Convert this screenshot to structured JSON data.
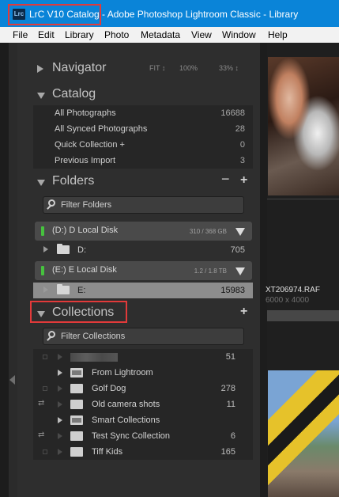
{
  "window": {
    "title": "Adobe Photoshop Lightroom Classic - Library",
    "catalog_label": "LrC V10 Catalog",
    "app_icon": "Lrc"
  },
  "menu": [
    "File",
    "Edit",
    "Library",
    "Photo",
    "Metadata",
    "View",
    "Window",
    "Help"
  ],
  "navigator": {
    "title": "Navigator",
    "options": [
      "FIT ↕",
      "100%",
      "33% ↕"
    ]
  },
  "catalog": {
    "title": "Catalog",
    "items": [
      {
        "label": "All Photographs",
        "count": "16688"
      },
      {
        "label": "All Synced Photographs",
        "count": "28"
      },
      {
        "label": "Quick Collection +",
        "count": "0"
      },
      {
        "label": "Previous Import",
        "count": "3"
      }
    ]
  },
  "folders": {
    "title": "Folders",
    "minus": "−",
    "plus": "+",
    "filter_placeholder": "Filter Folders",
    "volumes": [
      {
        "name": "(D:) D Local Disk",
        "size": "310 / 368 GB",
        "folder": "D:",
        "count": "705"
      },
      {
        "name": "(E:) E Local Disk",
        "size": "1.2 / 1.8 TB",
        "folder": "E:",
        "count": "15983"
      }
    ]
  },
  "collections": {
    "title": "Collections",
    "plus": "+",
    "filter_placeholder": "Filter Collections",
    "items": [
      {
        "label": "",
        "count": "51"
      },
      {
        "label": "From Lightroom",
        "count": ""
      },
      {
        "label": "Golf Dog",
        "count": "278"
      },
      {
        "label": "Old camera shots",
        "count": "11"
      },
      {
        "label": "Smart Collections",
        "count": ""
      },
      {
        "label": "Test Sync Collection",
        "count": "6"
      },
      {
        "label": "Tiff Kids",
        "count": "165"
      }
    ]
  },
  "grid": {
    "filename": "XT206974.RAF",
    "dimensions": "6000 x 4000"
  },
  "colors": {
    "title_bar": "#0a84d8",
    "highlight": "#e23a3a",
    "volume_led": "#46c23e"
  }
}
